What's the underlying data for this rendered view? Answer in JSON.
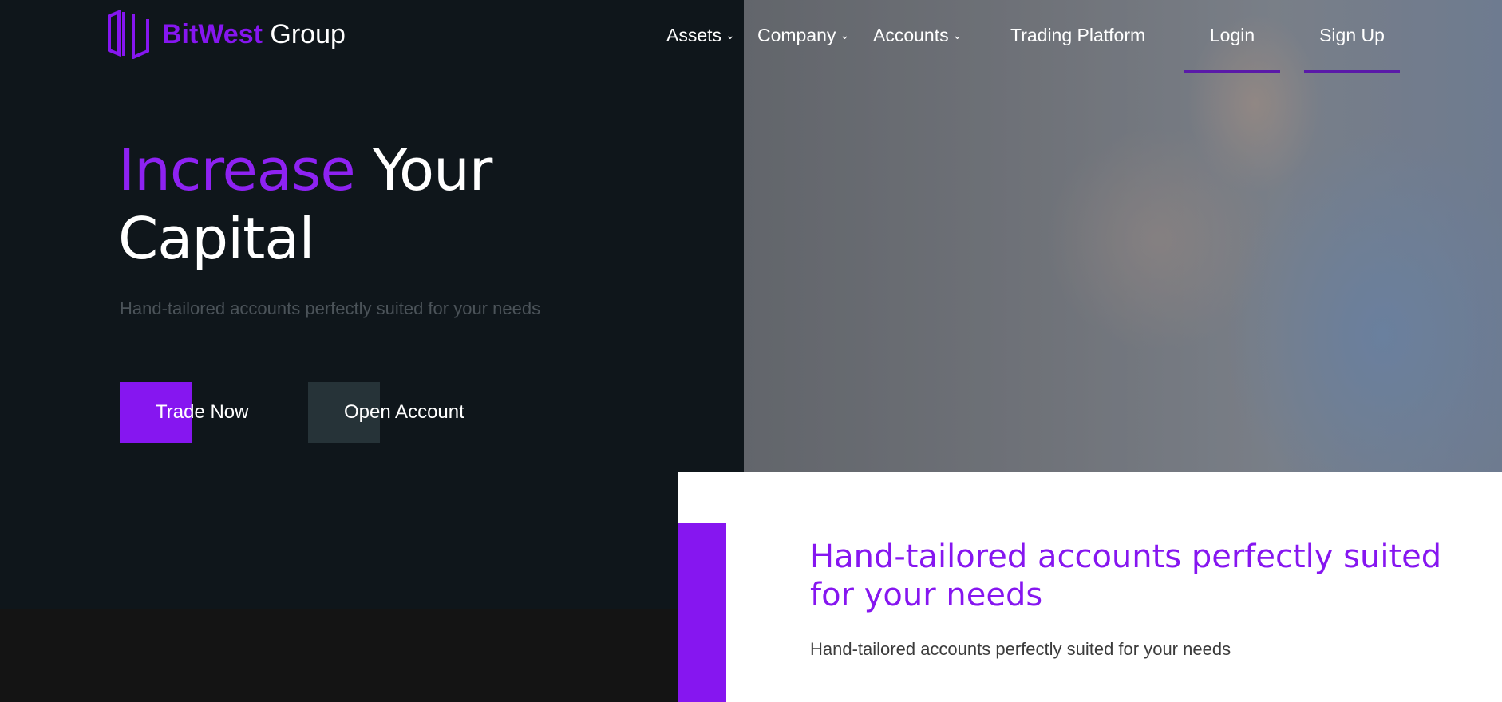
{
  "brand": {
    "name_accent": "BitWest",
    "name_rest": "Group",
    "accent_color": "#8616f0"
  },
  "nav": {
    "items": [
      {
        "label": "Assets",
        "dropdown": true,
        "icon": "chevron-down-icon"
      },
      {
        "label": "Company",
        "dropdown": true,
        "icon": "chevron-down-icon"
      },
      {
        "label": "Accounts",
        "dropdown": true,
        "icon": "chevron-down-icon"
      },
      {
        "label": "Trading Platform",
        "dropdown": false
      }
    ],
    "login_label": "Login",
    "signup_label": "Sign Up"
  },
  "hero": {
    "headline_accent": "Increase",
    "headline_rest_1": "Your",
    "headline_rest_2": "Capital",
    "subtitle": "Hand-tailored accounts perfectly suited for your needs",
    "trade_button": "Trade Now",
    "open_account_button": "Open Account"
  },
  "card": {
    "title": "Hand-tailored accounts perfectly suited for your needs",
    "text": "Hand-tailored accounts perfectly suited for your needs"
  },
  "colors": {
    "dark_bg": "#0f161b",
    "button_secondary": "#263338",
    "card_bg": "#ffffff"
  }
}
